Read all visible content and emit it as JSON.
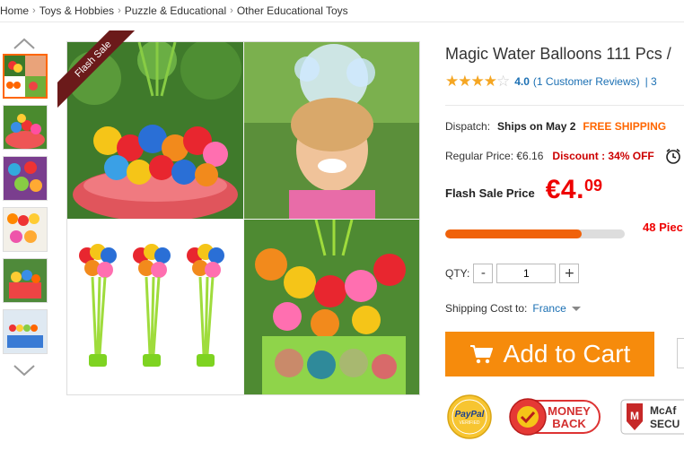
{
  "breadcrumb": [
    "Home",
    "Toys & Hobbies",
    "Puzzle & Educational",
    "Other Educational Toys"
  ],
  "gallery": {
    "ribbon": "Flash Sale",
    "thumb_count": 6
  },
  "product": {
    "title": "Magic Water Balloons 111 Pcs /",
    "rating": {
      "stars": 4.0,
      "score": "4.0",
      "reviews": "(1 Customer Reviews)",
      "more": "| 3"
    },
    "dispatch": {
      "label": "Dispatch:",
      "ships": "Ships on May 2",
      "shipping": "FREE SHIPPING"
    },
    "regular_price": "Regular Price: €6.16",
    "discount": "Discount : 34% OFF",
    "flash": {
      "label": "Flash Sale Price",
      "price": "€4.",
      "cents": "09"
    },
    "sold_progress": 0.76,
    "pieces": "48 Piec",
    "qty": {
      "label": "QTY:",
      "value": "1",
      "minus": "-",
      "plus": "+"
    },
    "shipping_cost": {
      "label": "Shipping Cost to:",
      "country": "France"
    },
    "add_to_cart": "Add to Cart"
  },
  "badges": {
    "paypal": [
      "PayPal",
      "VERIFIED"
    ],
    "moneyback": [
      "MONEY",
      "BACK"
    ],
    "mcafee": [
      "McAf",
      "SECU"
    ]
  },
  "colors": {
    "accent": "#f68b0c",
    "price": "#ee0000",
    "link": "#1a6fb3",
    "free_shipping": "#ff6600"
  }
}
